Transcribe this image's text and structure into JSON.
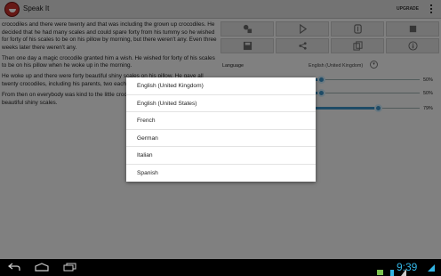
{
  "app": {
    "title": "Speak It",
    "upgrade_label": "UPGRADE"
  },
  "text_pane": {
    "paragraphs": [
      "crocodiles and there were twenty and that was including the grown up crocodiles.  He decided that he had many scales and could spare forty from his tummy so he wished for forty of his scales to be on his pillow by morning, but there weren't any.  Even three weeks later there weren't any.",
      "Then one day a magic crocodile granted him a wish. He wished for forty of his scales to be on his pillow when he woke up in the morning.",
      "He woke up and there were forty beautiful shiny scales on his pillow.  He gave all twenty crocodiles, including his parents, two each.",
      "From then on everybody was kind to the little crocodile and he gave away forty of his beautiful shiny scales."
    ]
  },
  "controls": {
    "row1": [
      "speak-options-icon",
      "play-icon",
      "pause-icon",
      "stop-icon"
    ],
    "row2": [
      "save-icon",
      "share-icon",
      "copy-icon",
      "info-icon"
    ]
  },
  "settings": {
    "language_label": "Language",
    "language_value": "English (United Kingdom)",
    "sliders": [
      {
        "name": "speech-rate",
        "value": 50,
        "value_label": "50%"
      },
      {
        "name": "pitch",
        "value": 50,
        "value_label": "50%"
      },
      {
        "name": "volume",
        "value": 79,
        "value_label": "79%"
      }
    ]
  },
  "language_dialog": {
    "options": [
      "English (United Kingdom)",
      "English (United States)",
      "French",
      "German",
      "Italian",
      "Spanish"
    ]
  },
  "navbar": {
    "clock": "9:39"
  },
  "colors": {
    "accent": "#3a8fc0",
    "clock": "#33b5e5",
    "app_icon": "#c0302a"
  }
}
